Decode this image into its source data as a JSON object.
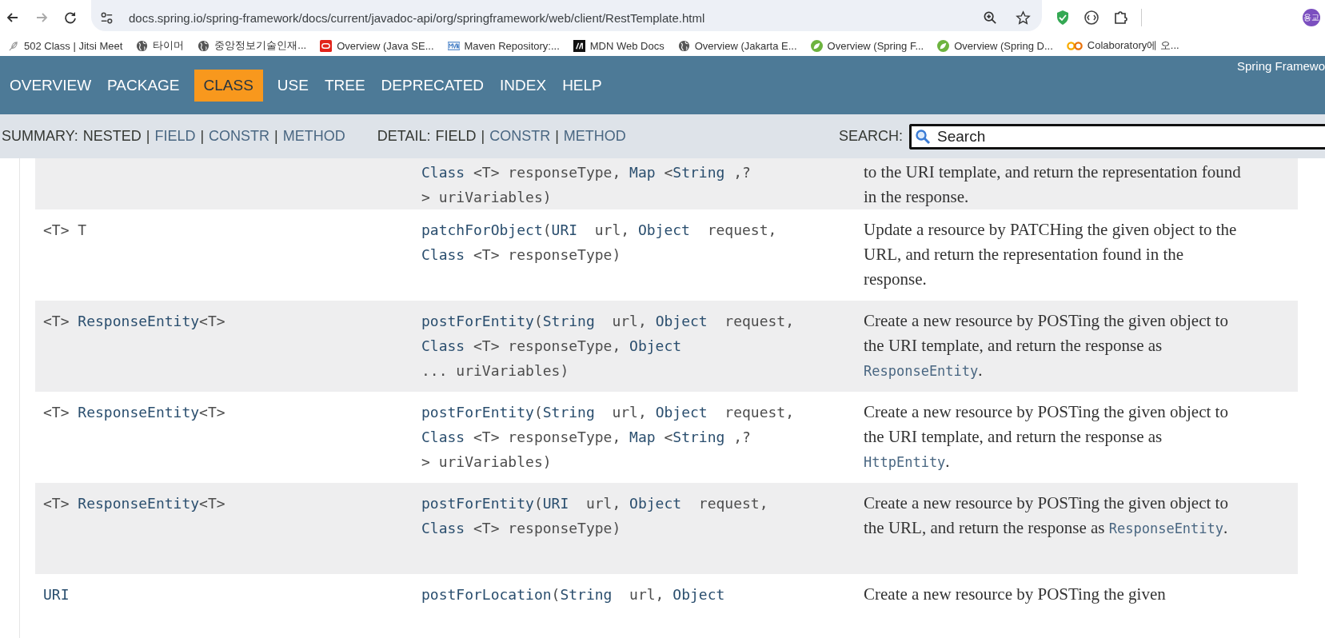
{
  "browser": {
    "url": "docs.spring.io/spring-framework/docs/current/javadoc-api/org/springframework/web/client/RestTemplate.html",
    "profile": "용교",
    "bookmarks": [
      {
        "kind": "feather",
        "label": "502 Class | Jitsi Meet"
      },
      {
        "kind": "globe",
        "label": "타이머"
      },
      {
        "kind": "globe",
        "label": "중앙정보기술인재..."
      },
      {
        "kind": "oracle",
        "label": "Overview (Java SE..."
      },
      {
        "kind": "mvn",
        "label": "Maven Repository:..."
      },
      {
        "kind": "mdn",
        "label": "MDN Web Docs"
      },
      {
        "kind": "globe",
        "label": "Overview (Jakarta E..."
      },
      {
        "kind": "spring",
        "label": "Overview (Spring F..."
      },
      {
        "kind": "spring",
        "label": "Overview (Spring D..."
      },
      {
        "kind": "colab",
        "label": "Colaboratory에 오..."
      }
    ]
  },
  "navbar": {
    "items": [
      {
        "label": "OVERVIEW",
        "selected": false
      },
      {
        "label": "PACKAGE",
        "selected": false
      },
      {
        "label": "CLASS",
        "selected": true
      },
      {
        "label": "USE",
        "selected": false
      },
      {
        "label": "TREE",
        "selected": false
      },
      {
        "label": "DEPRECATED",
        "selected": false
      },
      {
        "label": "INDEX",
        "selected": false
      },
      {
        "label": "HELP",
        "selected": false
      }
    ],
    "title": "Spring Framewo"
  },
  "subnav": {
    "separator": "|",
    "groups": [
      {
        "label": "SUMMARY:",
        "items": [
          {
            "text": "NESTED",
            "link": false
          },
          {
            "text": "FIELD",
            "link": true
          },
          {
            "text": "CONSTR",
            "link": true
          },
          {
            "text": "METHOD",
            "link": true
          }
        ]
      },
      {
        "label": "DETAIL:",
        "items": [
          {
            "text": "FIELD",
            "link": false
          },
          {
            "text": "CONSTR",
            "link": true
          },
          {
            "text": "METHOD",
            "link": true
          }
        ]
      }
    ],
    "search": {
      "label": "SEARCH:",
      "placeholder": "Search"
    }
  },
  "rows": [
    {
      "type": [],
      "signature": [
        [
          {
            "text": "Class",
            "link": true
          },
          {
            "text": " <T> responseType, ",
            "link": false
          },
          {
            "text": "Map",
            "link": true
          },
          {
            "text": " <",
            "link": false
          },
          {
            "text": "String",
            "link": true
          },
          {
            "text": " ,?",
            "link": false
          }
        ],
        [
          {
            "text": "> uriVariables)",
            "link": false
          }
        ]
      ],
      "description": [
        {
          "text": "to the URI template, and return the representation found in the response.",
          "code": false
        }
      ]
    },
    {
      "type": [
        {
          "text": "<T> T",
          "link": false
        }
      ],
      "signature": [
        [
          {
            "text": "patchForObject",
            "link": true
          },
          {
            "text": "(",
            "link": false
          },
          {
            "text": "URI",
            "link": true
          },
          {
            "text": "  url, ",
            "link": false
          },
          {
            "text": "Object",
            "link": true
          },
          {
            "text": "  request,",
            "link": false
          }
        ],
        [
          {
            "text": "Class",
            "link": true
          },
          {
            "text": " <T> responseType)",
            "link": false
          }
        ]
      ],
      "description": [
        {
          "text": "Update a resource by PATCHing the given object to the URL, and return the representation found in the response.",
          "code": false
        }
      ]
    },
    {
      "type": [
        {
          "text": "<T> ",
          "link": false
        },
        {
          "text": "ResponseEntity",
          "link": true
        },
        {
          "text": "<T>",
          "link": false
        }
      ],
      "signature": [
        [
          {
            "text": "postForEntity",
            "link": true
          },
          {
            "text": "(",
            "link": false
          },
          {
            "text": "String",
            "link": true
          },
          {
            "text": "  url, ",
            "link": false
          },
          {
            "text": "Object",
            "link": true
          },
          {
            "text": "  request,",
            "link": false
          }
        ],
        [
          {
            "text": "Class",
            "link": true
          },
          {
            "text": " <T> responseType, ",
            "link": false
          },
          {
            "text": "Object",
            "link": true
          }
        ],
        [
          {
            "text": "... uriVariables)",
            "link": false
          }
        ]
      ],
      "description": [
        {
          "text": "Create a new resource by POSTing the given object to the URI template, and return the response as ",
          "code": false
        },
        {
          "text": "ResponseEntity",
          "code": true
        },
        {
          "text": ".",
          "code": false
        }
      ]
    },
    {
      "type": [
        {
          "text": "<T> ",
          "link": false
        },
        {
          "text": "ResponseEntity",
          "link": true
        },
        {
          "text": "<T>",
          "link": false
        }
      ],
      "signature": [
        [
          {
            "text": "postForEntity",
            "link": true
          },
          {
            "text": "(",
            "link": false
          },
          {
            "text": "String",
            "link": true
          },
          {
            "text": "  url, ",
            "link": false
          },
          {
            "text": "Object",
            "link": true
          },
          {
            "text": "  request,",
            "link": false
          }
        ],
        [
          {
            "text": "Class",
            "link": true
          },
          {
            "text": " <T> responseType, ",
            "link": false
          },
          {
            "text": "Map",
            "link": true
          },
          {
            "text": " <",
            "link": false
          },
          {
            "text": "String",
            "link": true
          },
          {
            "text": " ,?",
            "link": false
          }
        ],
        [
          {
            "text": "> uriVariables)",
            "link": false
          }
        ]
      ],
      "description": [
        {
          "text": "Create a new resource by POSTing the given object to the URI template, and return the response as ",
          "code": false
        },
        {
          "text": "HttpEntity",
          "code": true
        },
        {
          "text": ".",
          "code": false
        }
      ]
    },
    {
      "type": [
        {
          "text": "<T> ",
          "link": false
        },
        {
          "text": "ResponseEntity",
          "link": true
        },
        {
          "text": "<T>",
          "link": false
        }
      ],
      "signature": [
        [
          {
            "text": "postForEntity",
            "link": true
          },
          {
            "text": "(",
            "link": false
          },
          {
            "text": "URI",
            "link": true
          },
          {
            "text": "  url, ",
            "link": false
          },
          {
            "text": "Object",
            "link": true
          },
          {
            "text": "  request,",
            "link": false
          }
        ],
        [
          {
            "text": "Class",
            "link": true
          },
          {
            "text": " <T> responseType)",
            "link": false
          }
        ]
      ],
      "description": [
        {
          "text": "Create a new resource by POSTing the given object to the URL, and return the response as ",
          "code": false
        },
        {
          "text": "ResponseEntity",
          "code": true
        },
        {
          "text": ".",
          "code": false
        }
      ]
    },
    {
      "type": [
        {
          "text": "URI",
          "link": true
        }
      ],
      "signature": [
        [
          {
            "text": "postForLocation",
            "link": true
          },
          {
            "text": "(",
            "link": false
          },
          {
            "text": "String",
            "link": true
          },
          {
            "text": "  url, ",
            "link": false
          },
          {
            "text": "Object",
            "link": true
          }
        ]
      ],
      "description": [
        {
          "text": "Create a new resource by POSTing the given",
          "code": false
        }
      ]
    }
  ]
}
